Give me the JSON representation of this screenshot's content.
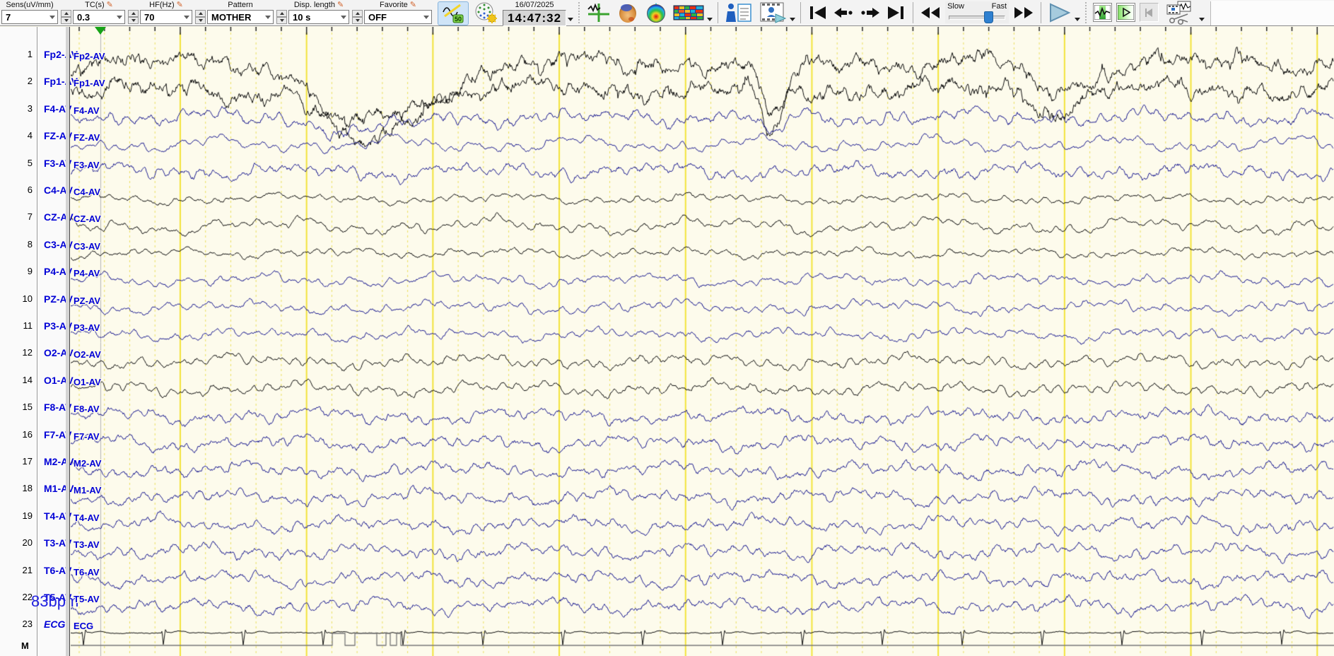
{
  "toolbar": {
    "sens": {
      "label": "Sens(uV/mm)",
      "value": "7"
    },
    "tc": {
      "label": "TC(s)",
      "value": "0.3"
    },
    "hf": {
      "label": "HF(Hz)",
      "value": "70"
    },
    "pattern": {
      "label": "Pattern",
      "value": "MOTHER"
    },
    "disp": {
      "label": "Disp. length",
      "value": "10 s"
    },
    "favorite": {
      "label": "Favorite",
      "value": "OFF"
    },
    "notch_badge": "50",
    "date": "16/07/2025",
    "time": "14:47:32",
    "slider": {
      "left": "Slow",
      "right": "Fast"
    }
  },
  "eeg": {
    "channels": [
      {
        "num": "1",
        "label": "Fp2-AV",
        "profile": "fp",
        "color": "#0c0c0c"
      },
      {
        "num": "2",
        "label": "Fp1-AV",
        "profile": "fp",
        "color": "#0c0c0c"
      },
      {
        "num": "3",
        "label": "F4-AV",
        "profile": "front",
        "color": "#1a1a8f"
      },
      {
        "num": "4",
        "label": "FZ-AV",
        "profile": "mid",
        "color": "#1a1a8f"
      },
      {
        "num": "5",
        "label": "F3-AV",
        "profile": "front",
        "color": "#1a1a8f"
      },
      {
        "num": "6",
        "label": "C4-AV",
        "profile": "cent",
        "color": "#0c0c0c"
      },
      {
        "num": "7",
        "label": "CZ-AV",
        "profile": "mid",
        "color": "#0c0c0c"
      },
      {
        "num": "8",
        "label": "C3-AV",
        "profile": "cent",
        "color": "#0c0c0c"
      },
      {
        "num": "9",
        "label": "P4-AV",
        "profile": "par",
        "color": "#1a1a8f"
      },
      {
        "num": "10",
        "label": "PZ-AV",
        "profile": "par",
        "color": "#1a1a8f"
      },
      {
        "num": "11",
        "label": "P3-AV",
        "profile": "par",
        "color": "#1a1a8f"
      },
      {
        "num": "12",
        "label": "O2-AV",
        "profile": "occ",
        "color": "#0c0c0c"
      },
      {
        "num": "14",
        "label": "O1-AV",
        "profile": "occ",
        "color": "#0c0c0c"
      },
      {
        "num": "15",
        "label": "F8-AV",
        "profile": "temp",
        "color": "#1a1a8f"
      },
      {
        "num": "16",
        "label": "F7-AV",
        "profile": "temp",
        "color": "#1a1a8f"
      },
      {
        "num": "17",
        "label": "M2-AV",
        "profile": "temp",
        "color": "#1a1a8f"
      },
      {
        "num": "18",
        "label": "M1-AV",
        "profile": "temp",
        "color": "#1a1a8f"
      },
      {
        "num": "19",
        "label": "T4-AV",
        "profile": "temp",
        "color": "#1a1a8f"
      },
      {
        "num": "20",
        "label": "T3-AV",
        "profile": "temp",
        "color": "#1a1a8f"
      },
      {
        "num": "21",
        "label": "T6-AV",
        "profile": "temp",
        "color": "#1a1a8f"
      },
      {
        "num": "22",
        "label": "T5-AV",
        "profile": "temp",
        "color": "#1a1a8f"
      }
    ],
    "ecg": {
      "num": "23",
      "label": "ECG",
      "bpm": "83bpm"
    },
    "marker": {
      "label": "M"
    },
    "colors": {
      "background": "#fdfbec",
      "grid_solid": "#f2e33a",
      "grid_dashed": "#eadf5e",
      "trace_black": "#0c0c0c",
      "trace_blue": "#1a1a8f",
      "marker_gray": "#787878",
      "cursor_gray": "#b4b4b4"
    }
  }
}
